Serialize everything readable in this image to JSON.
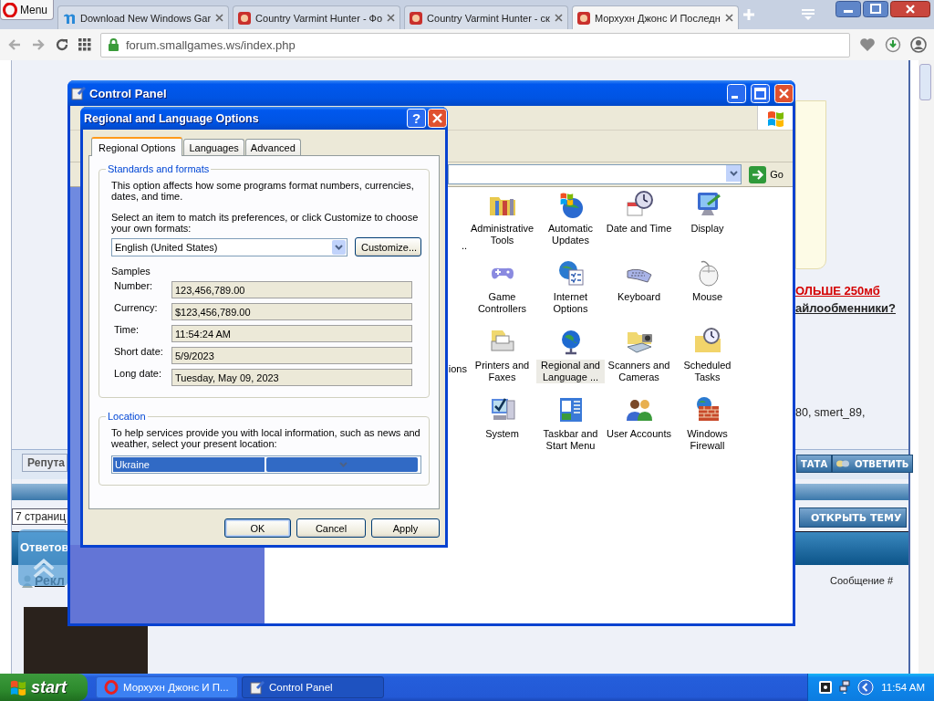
{
  "browser": {
    "menu_button": "Menu",
    "tabs": [
      {
        "title": "Download New Windows Gar",
        "kind": "m",
        "selected": false
      },
      {
        "title": "Country Varmint Hunter - Фо",
        "kind": "site",
        "selected": false
      },
      {
        "title": "Country Varmint Hunter - ск",
        "kind": "site",
        "selected": false
      },
      {
        "title": "Морхухн Джонс И Последн",
        "kind": "site",
        "selected": true
      }
    ],
    "url": "forum.smallgames.ws/index.php"
  },
  "forum": {
    "link_red": "ОЛЬШЕ 250мб",
    "link_dark": "айлообменники?",
    "users": [
      {
        "name": "80",
        "after": ", "
      },
      {
        "name": "smert_89",
        "after": ","
      }
    ],
    "reputation": "Репута",
    "action_buttons": [
      "ТАТА",
      "ОТВЕТИТЬ"
    ],
    "pages": "7 страниц",
    "open_topic": "ОТКРЫТЬ ТЕМУ",
    "answers_header": "Ответов",
    "ad_link": "Рекл",
    "message_label": "Сообщение",
    "message_link": "#"
  },
  "control_panel": {
    "title": "Control Panel",
    "go": "Go",
    "partial_labels": [
      "..",
      "ions"
    ],
    "items": [
      {
        "label": "Administrative Tools",
        "kind": "admin",
        "selected": false
      },
      {
        "label": "Automatic Updates",
        "kind": "updates",
        "selected": false
      },
      {
        "label": "Date and Time",
        "kind": "datetime",
        "selected": false
      },
      {
        "label": "Display",
        "kind": "display",
        "selected": false
      },
      {
        "label": "Game Controllers",
        "kind": "game",
        "selected": false
      },
      {
        "label": "Internet Options",
        "kind": "internet",
        "selected": false
      },
      {
        "label": "Keyboard",
        "kind": "keyboard",
        "selected": false
      },
      {
        "label": "Mouse",
        "kind": "mouse",
        "selected": false
      },
      {
        "label": "Printers and Faxes",
        "kind": "printer",
        "selected": false
      },
      {
        "label": "Regional and Language ...",
        "kind": "regional",
        "selected": true
      },
      {
        "label": "Scanners and Cameras",
        "kind": "scanner",
        "selected": false
      },
      {
        "label": "Scheduled Tasks",
        "kind": "tasks",
        "selected": false
      },
      {
        "label": "System",
        "kind": "system",
        "selected": false
      },
      {
        "label": "Taskbar and Start Menu",
        "kind": "taskbar",
        "selected": false
      },
      {
        "label": "User Accounts",
        "kind": "users",
        "selected": false
      },
      {
        "label": "Windows Firewall",
        "kind": "firewall",
        "selected": false
      }
    ]
  },
  "dialog": {
    "title": "Regional and Language Options",
    "help": "?",
    "tabs": [
      {
        "label": "Regional Options",
        "selected": true
      },
      {
        "label": "Languages",
        "selected": false
      },
      {
        "label": "Advanced",
        "selected": false
      }
    ],
    "standards": {
      "legend": "Standards and formats",
      "description": "This option affects how some programs format numbers, currencies, dates, and time.",
      "prompt": "Select an item to match its preferences, or click Customize to choose your own formats:",
      "format": "English (United States)",
      "customize": "Customize...",
      "samples_label": "Samples",
      "samples": [
        {
          "label": "Number:",
          "value": "123,456,789.00"
        },
        {
          "label": "Currency:",
          "value": "$123,456,789.00"
        },
        {
          "label": "Time:",
          "value": "11:54:24 AM"
        },
        {
          "label": "Short date:",
          "value": "5/9/2023"
        },
        {
          "label": "Long date:",
          "value": "Tuesday, May 09, 2023"
        }
      ]
    },
    "location": {
      "legend": "Location",
      "description": "To help services provide you with local information, such as news and weather, select your present location:",
      "value": "Ukraine"
    },
    "buttons": [
      {
        "label": "OK",
        "default": true
      },
      {
        "label": "Cancel",
        "default": false
      },
      {
        "label": "Apply",
        "default": false
      }
    ]
  },
  "taskbar": {
    "start": "start",
    "tasks": [
      {
        "title": "Морхухн Джонс И П...",
        "kind": "opera",
        "selected": false
      },
      {
        "title": "Control Panel",
        "kind": "cp",
        "selected": true
      }
    ],
    "clock": "11:54 AM"
  }
}
